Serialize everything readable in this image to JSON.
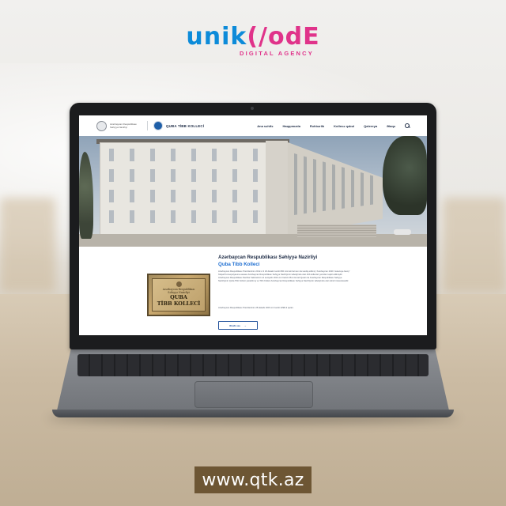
{
  "agency_logo": {
    "part1": "unik",
    "part2": "(/odE",
    "subtitle": "DIGITAL AGENCY"
  },
  "site": {
    "header": {
      "ministry_small": "Azərbaycan Respublikası Səhiyyə Nazirliyi",
      "college_name": "QUBA TİBB KOLLECİ",
      "nav": [
        "Ana səhifə",
        "Haqqımızda",
        "Rəhbərlik",
        "Kollecə qəbul",
        "Qalereya",
        "Əlaqə"
      ]
    },
    "content": {
      "ministry_title": "Azərbaycan Respublikası Səhiyyə Nazirliyi",
      "college_title": "Quba Tibb Kolleci",
      "paragraph1": "Azərbaycan Respublikası Prezidentinin 2012-ci il 29 dekabr tarixli 800 nömrəli fərmanı ilə təsdiq edilmiş \"Azərbaycan 2020: Gələcəyə baxış\" İnkişaf Konsepsiyasına əsasən Azərbaycan Respublikası Səhiyyə Nazirliyinin tabeliyində olan tibb kollecləri yenidən təşkil edilmişdir. Azərbaycan Respublikası Nazirlər Kabinetinin 14 sentyabr 2013-cü il tarixli 261 nömrəli Qərarı ilə Azərbaycan Respublikası Səhiyyə Nazirliyinin Quba Tibb Kolleci yaradılmış və Tibb Kolleci Azərbaycan Respublikası Səhiyyə Nazirliyinin tabeliyində olan təhsil müəssisəsidir.",
      "paragraph2": "Azərbaycan Respublikası Prezidentinin 28 dekabr 2015-ci il tarixli 429R-li qərarı.",
      "more_label": "Ətraflı oxu",
      "plaque": {
        "line1": "Azərbaycan Respublikası",
        "line2": "Səhiyyə Nazirliyi",
        "line3": "QUBA",
        "line4": "TİBB KOLLECİ"
      }
    }
  },
  "url_banner": "www.qtk.az",
  "colors": {
    "logo_blue": "#0d8bd9",
    "logo_pink": "#e0338a",
    "site_navy": "#1c2a44",
    "site_accent_blue": "#1f6fd1",
    "banner_brown": "#6d5634"
  }
}
